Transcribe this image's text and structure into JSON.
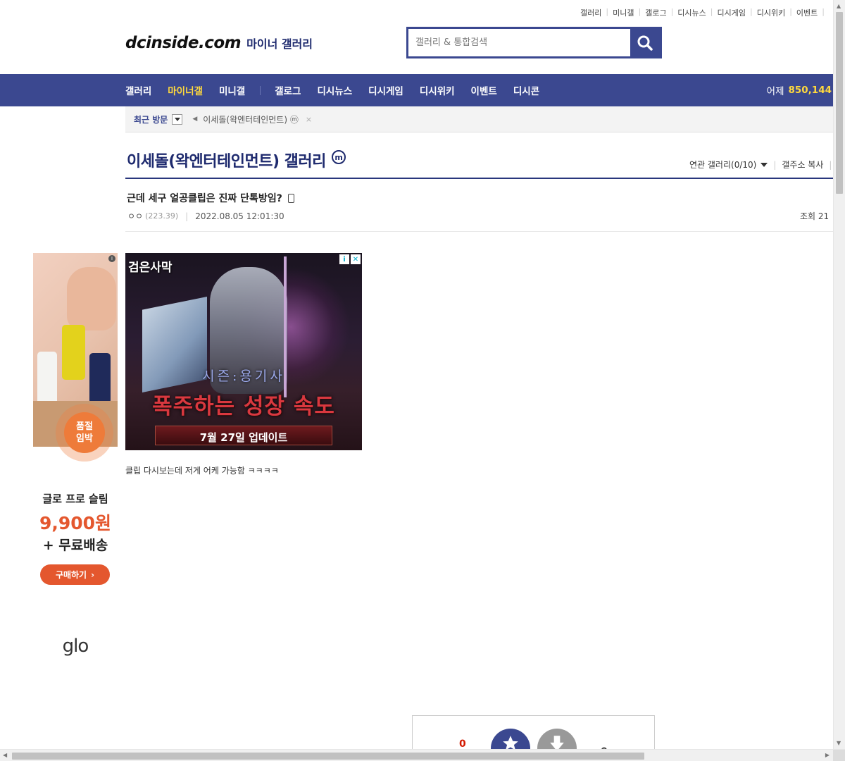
{
  "top_links": [
    "갤러리",
    "미니갤",
    "갤로그",
    "디시뉴스",
    "디시게임",
    "디시위키",
    "이벤트"
  ],
  "logo": {
    "main": "dcinside.com",
    "sub": "마이너 갤러리"
  },
  "search": {
    "placeholder": "갤러리 & 통합검색"
  },
  "gnb": {
    "items": [
      "갤러리",
      "마이너갤",
      "미니갤",
      "갤로그",
      "디시뉴스",
      "디시게임",
      "디시위키",
      "이벤트",
      "디시콘"
    ],
    "active": "마이너갤",
    "yesterday_label": "어제",
    "yesterday_count": "850,144"
  },
  "visit_bar": {
    "label": "최근 방문",
    "recent_item": "이세돌(왁엔터테인먼트) ⓜ",
    "close": "×"
  },
  "gallery": {
    "title": "이세돌(왁엔터테인먼트) 갤러리",
    "badge": "m",
    "related": "연관 갤러리(0/10)",
    "copy_address": "갤주소 복사"
  },
  "post": {
    "title": "근데 세구 얼공클립은 진짜 단톡방임?",
    "author": "ㅇㅇ",
    "ip": "(223.39)",
    "date": "2022.08.05 12:01:30",
    "views": "조회 21",
    "body": "클립 다시보는데 저게 어케 가능함 ㅋㅋㅋㅋ"
  },
  "side_ad": {
    "badge_line1": "품절",
    "badge_line2": "임박",
    "product": "글로 프로 슬림",
    "price": "9,900원",
    "shipping": "+ 무료배송",
    "buy": "구매하기",
    "brand": "glo",
    "info": "i"
  },
  "main_ad": {
    "brand": "검은사막",
    "season": "시즌:용기사",
    "headline": "폭주하는 성장 속도",
    "update": "7월 27일 업데이트"
  },
  "vote": {
    "up_count": "0",
    "down_count": "0"
  },
  "colors": {
    "brand_blue": "#3b4890",
    "highlight_yellow": "#ffd93d",
    "accent_red": "#d31900",
    "ad_orange": "#e4572e"
  }
}
